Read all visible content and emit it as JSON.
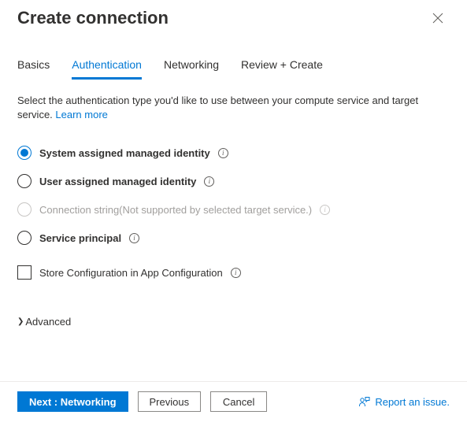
{
  "header": {
    "title": "Create connection"
  },
  "tabs": {
    "basics": "Basics",
    "authentication": "Authentication",
    "networking": "Networking",
    "review": "Review + Create"
  },
  "activeTab": "authentication",
  "description": {
    "text": "Select the authentication type you'd like to use between your compute service and target service. ",
    "link": "Learn more"
  },
  "authOptions": {
    "system": "System assigned managed identity",
    "user": "User assigned managed identity",
    "connstr": "Connection string",
    "connstr_note": "(Not supported by selected target service.)",
    "principal": "Service principal"
  },
  "storeConfig": "Store Configuration in App Configuration",
  "advanced": "Advanced",
  "footer": {
    "next": "Next : Networking",
    "previous": "Previous",
    "cancel": "Cancel",
    "report": "Report an issue."
  }
}
